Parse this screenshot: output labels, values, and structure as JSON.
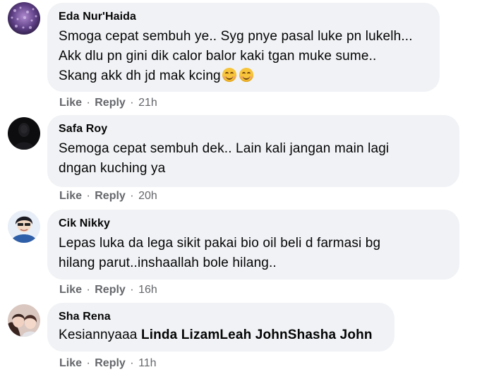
{
  "comments": [
    {
      "author": "Eda Nur'Haida",
      "lines": [
        "Smoga cepat sembuh ye.. Syg pnye pasal luke pn lukelh...",
        "Akk dlu pn gini dik calor balor kaki tgan muke sume..",
        "Skang akk dh jd mak kcing"
      ],
      "emojis": [
        "smiling-face-emoji",
        "smiling-face-emoji"
      ],
      "like": "Like",
      "reply": "Reply",
      "time": "21h"
    },
    {
      "author": "Safa Roy",
      "lines": [
        "Semoga cepat sembuh dek.. Lain kali jangan main lagi",
        "dngan kuching ya"
      ],
      "like": "Like",
      "reply": "Reply",
      "time": "20h"
    },
    {
      "author": "Cik Nikky",
      "lines": [
        "Lepas luka da lega sikit pakai bio oil beli d farmasi bg",
        "hilang parut..inshaallah bole hilang.."
      ],
      "like": "Like",
      "reply": "Reply",
      "time": "16h"
    },
    {
      "author": "Sha Rena",
      "prefix": "Kesiannyaaa ",
      "tags": [
        "Linda Lizam",
        "Leah John",
        "Shasha John"
      ],
      "like": "Like",
      "reply": "Reply",
      "time": "11h"
    }
  ],
  "separator": "·",
  "colors": {
    "bubble": "#f0f2f5",
    "meta_text": "#65676b",
    "body_text": "#050505"
  }
}
